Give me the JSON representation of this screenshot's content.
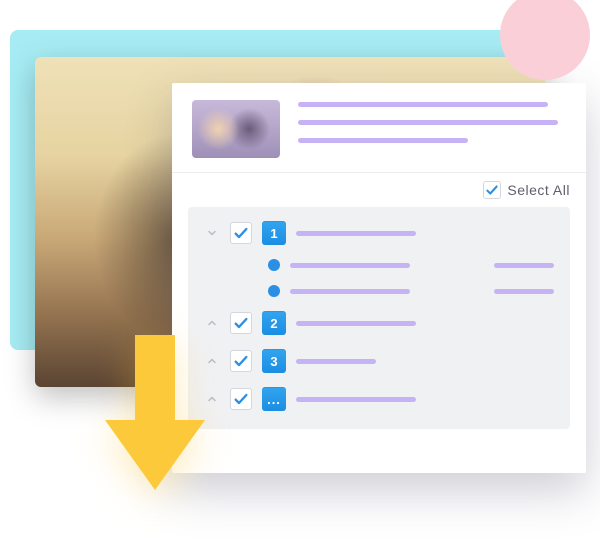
{
  "colors": {
    "cyan_bg": "#a7ecf4",
    "pink_circle": "#fbcfd7",
    "accent_line": "#c6b3f6",
    "badge_blue": "#1b8ee3",
    "arrow_yellow": "#fbc93a",
    "check_blue": "#2a8fe5"
  },
  "select_all": {
    "label": "Select All",
    "checked": true
  },
  "list": {
    "items": [
      {
        "badge": "1",
        "checked": true,
        "expanded": true,
        "has_children": true
      },
      {
        "badge": "2",
        "checked": true,
        "expanded": false,
        "has_children": false
      },
      {
        "badge": "3",
        "checked": true,
        "expanded": false,
        "has_children": false
      },
      {
        "badge": "...",
        "checked": true,
        "expanded": false,
        "has_children": false
      }
    ]
  },
  "icons": {
    "chevron_down": "chevron-down-icon",
    "chevron_up": "chevron-up-icon",
    "checkmark": "checkmark-icon",
    "download_arrow": "download-arrow-icon",
    "bullet": "bullet-icon"
  }
}
